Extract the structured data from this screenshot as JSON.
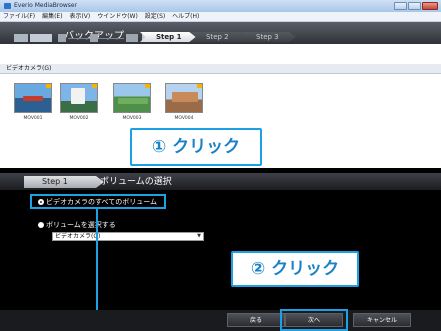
{
  "window": {
    "title": "Everio MediaBrowser"
  },
  "menu": [
    "ファイル(F)",
    "編集(E)",
    "表示(V)",
    "ウインドウ(W)",
    "設定(S)",
    "ヘルプ(H)"
  ],
  "stepbar": {
    "title": "バックアップ",
    "steps": [
      "Step 1",
      "Step 2",
      "Step 3"
    ]
  },
  "camera": {
    "header": "ビデオカメラ(G)"
  },
  "thumbnails": [
    {
      "label": "MOV001"
    },
    {
      "label": "MOV002"
    },
    {
      "label": "MOV003"
    },
    {
      "label": "MOV004"
    }
  ],
  "volume": {
    "step": "Step 1",
    "title": "ボリュームの選択",
    "options": [
      {
        "label": "ビデオカメラのすべてのボリューム",
        "checked": true
      },
      {
        "label": "ボリュームを選択する",
        "checked": false
      }
    ],
    "select_value": "ビデオカメラ(G)"
  },
  "callouts": [
    {
      "text": "① クリック"
    },
    {
      "text": "② クリック"
    }
  ],
  "buttons": {
    "back": "戻る",
    "next": "次へ",
    "cancel": "キャンセル"
  },
  "colors": {
    "accent": "#1da1e6",
    "panel": "#000000"
  }
}
